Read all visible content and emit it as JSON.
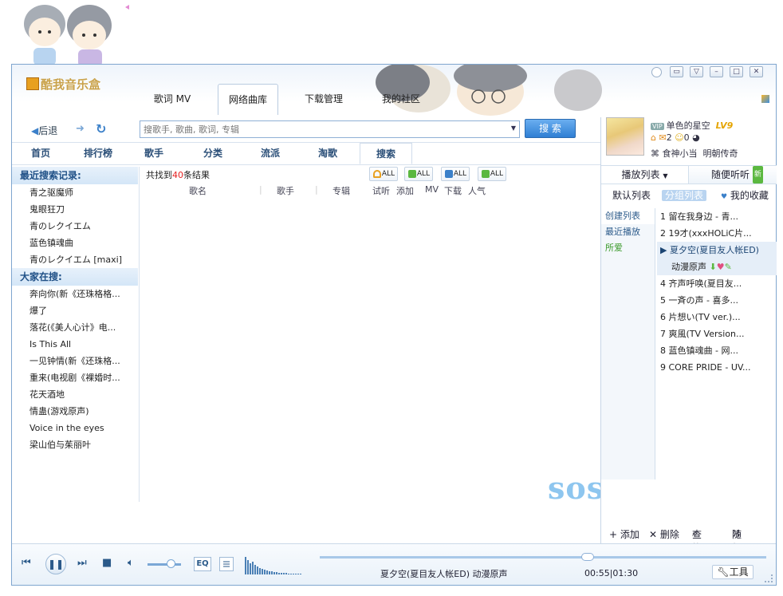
{
  "app": {
    "logo_text": "酷我音乐盒"
  },
  "top_tabs": [
    {
      "label": "歌词 MV"
    },
    {
      "label": "网络曲库",
      "active": true
    },
    {
      "label": "下载管理"
    },
    {
      "label": "我的社区"
    }
  ],
  "nav": {
    "back_label": "后退"
  },
  "search": {
    "placeholder": "搜歌手, 歌曲, 歌词, 专辑",
    "button_label": "搜 索"
  },
  "categories": [
    {
      "label": "首页"
    },
    {
      "label": "排行榜"
    },
    {
      "label": "歌手"
    },
    {
      "label": "分类"
    },
    {
      "label": "流派"
    },
    {
      "label": "淘歌"
    },
    {
      "label": "搜索",
      "active": true
    }
  ],
  "recent": {
    "header": "最近搜索记录:",
    "items": [
      "青之驱魔师",
      "鬼眼狂刀",
      "青のレクイエム",
      "蓝色镇魂曲",
      "青のレクイエム [maxi]"
    ]
  },
  "popular": {
    "header": "大家在搜:",
    "items": [
      "奔向你(新《还珠格格...",
      "爆了",
      "落花(《美人心计》电...",
      "Is This All",
      "一见钟情(新《还珠格...",
      "重来(电视剧《裸婚时...",
      "花天酒地",
      "情蛊(游戏原声)",
      "Voice in the eyes",
      "梁山伯与茱丽叶"
    ]
  },
  "results": {
    "prefix": "共找到",
    "count": "40",
    "suffix": "条结果"
  },
  "all_buttons": [
    "ALL",
    "ALL",
    "ALL",
    "ALL"
  ],
  "columns": [
    "歌名",
    "歌手",
    "专辑",
    "试听",
    "添加",
    "MV",
    "下载",
    "人气"
  ],
  "watermark": "sosg",
  "user": {
    "vip": "VIP",
    "name": "单色的星空",
    "level": "LV9",
    "mail_count": "2",
    "friend_count": "0",
    "line3": "食神小当",
    "line3b": "明朝传奇"
  },
  "playlist_tabs": {
    "tab1": "播放列表",
    "tab2": "随便听听",
    "new_badge": "新"
  },
  "sub_tabs": [
    "默认列表",
    "分组列表",
    "我的收藏"
  ],
  "playlist_side": [
    "创建列表",
    "最近播放",
    "所爱"
  ],
  "songs": [
    "1 留在我身边 - 青...",
    "2 19才(xxxHOLiC片...",
    "▶ 夏夕空(夏目友人帐ED)",
    "动漫原声",
    "4 齐声呼唤(夏目友...",
    "5 一斉の声 - 喜多...",
    "6 片想い(TV ver.)...",
    "7 爽風(TV Version...",
    "8 蓝色镇魂曲 - 网...",
    "9 CORE PRIDE - UV..."
  ],
  "right_tools": [
    "+ 添加",
    "✕ 删除",
    "查找",
    "随机"
  ],
  "player": {
    "eq_label": "EQ",
    "now_playing": "夏夕空(夏目友人帐ED) 动漫原声",
    "time": "00:55|01:30",
    "tools_label": "工具",
    "progress": 0.6,
    "volume": 0.7
  }
}
